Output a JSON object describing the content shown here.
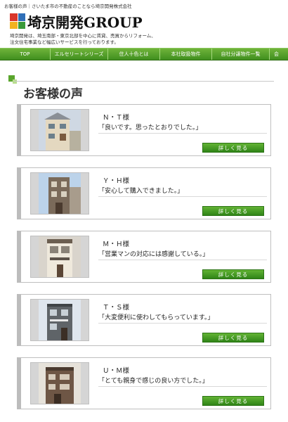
{
  "topline": "お客様の声｜さいたま市の不動産のことなら埼京開発株式会社",
  "logo": {
    "text": "埼京開発GROUP",
    "mark_colors": [
      "#d9362b",
      "#2f6fb8",
      "#f2b21e",
      "#3a9a3a"
    ]
  },
  "description": [
    "埼京開発は、埼玉南部・東京北部を中心に賃貸、売買からリフォーム、",
    "注文住宅事業など幅広いサービスを行っております。"
  ],
  "nav": {
    "items": [
      {
        "label": "TOP"
      },
      {
        "label": "エルセリートシリーズ"
      },
      {
        "label": "住人十色とは"
      },
      {
        "label": "本社取扱物件"
      },
      {
        "label": "自社分譲物件一覧"
      },
      {
        "label": "会"
      }
    ]
  },
  "page_title": "お客様の声",
  "testimonials": [
    {
      "name": "Ｎ・Ｔ様",
      "quote": "「良いです。思ったとおりでした。」",
      "button": "詳しく見る"
    },
    {
      "name": "Ｙ・Ｈ様",
      "quote": "「安心して購入できました。」",
      "button": "詳しく見る"
    },
    {
      "name": "Ｍ・Ｈ様",
      "quote": "「営業マンの対応には感謝している。」",
      "button": "詳しく見る"
    },
    {
      "name": "Ｔ・Ｓ様",
      "quote": "「大変便利に使わしてもらっています。」",
      "button": "詳しく見る"
    },
    {
      "name": "Ｕ・Ｍ様",
      "quote": "「とても親身で感じの良い方でした。」",
      "button": "詳しく見る"
    }
  ],
  "colors": {
    "nav_green": "#4f9f27",
    "button_green": "#3e8f1f",
    "card_accent": "#bcbcbc"
  }
}
